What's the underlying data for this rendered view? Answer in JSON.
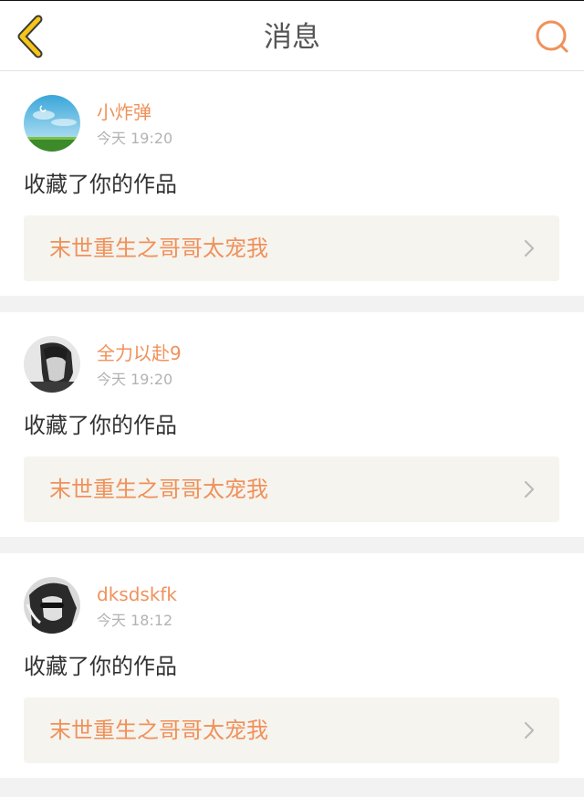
{
  "header": {
    "title": "消息",
    "back_icon": "chevron-left-icon",
    "search_icon": "search-icon",
    "back_color": "#f5c518",
    "search_color": "#f0915a"
  },
  "messages": [
    {
      "username": "小炸弹",
      "time": "今天 19:20",
      "action": "收藏了你的作品",
      "work_title": "末世重生之哥哥太宠我",
      "avatar_icon": "sky-landscape-avatar"
    },
    {
      "username": "全力以赴9",
      "time": "今天 19:20",
      "action": "收藏了你的作品",
      "work_title": "末世重生之哥哥太宠我",
      "avatar_icon": "portrait-avatar"
    },
    {
      "username": "dksdskfk",
      "time": "今天 18:12",
      "action": "收藏了你的作品",
      "work_title": "末世重生之哥哥太宠我",
      "avatar_icon": "portrait-avatar"
    }
  ],
  "colors": {
    "accent": "#f0915a",
    "card_bg": "#f5f4ef",
    "page_bg": "#f2f2f2"
  }
}
